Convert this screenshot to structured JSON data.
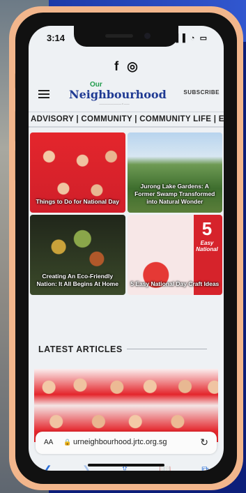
{
  "status": {
    "time": "3:14",
    "icons": "▐▐ ◔ ▭"
  },
  "social": {
    "facebook": "f",
    "instagram": "◎"
  },
  "header": {
    "logo_top": "Our",
    "logo_name": "Neighbourhood",
    "logo_tag": "———————— • ——",
    "subscribe": "SUBSCRIBE"
  },
  "nav": {
    "text": "ADVISORY | COMMUNITY | COMMUNITY LIFE | E"
  },
  "articles": [
    {
      "caption": "Things to Do for National Day"
    },
    {
      "caption": "Jurong Lake Gardens: A Former Swamp Transformed into Natural Wonder"
    },
    {
      "caption": "Creating An Eco-Friendly Nation: It All Begins At Home"
    },
    {
      "caption": "5 Easy National Day Craft Ideas"
    }
  ],
  "card4_overlay": {
    "number": "5",
    "text": "Easy National"
  },
  "latest": {
    "heading": "LATEST ARTICLES"
  },
  "browser": {
    "aa": "AA",
    "url": "urneighbourhood.jrtc.org.sg"
  },
  "colors": {
    "accent": "#2a6ed8",
    "brand_red": "#e4262c",
    "logo_blue": "#1f3a93",
    "frame": "#f2b68c"
  }
}
